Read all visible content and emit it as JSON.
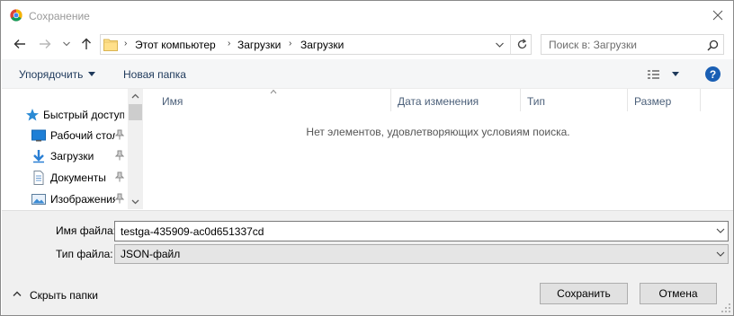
{
  "window": {
    "title": "Сохранение",
    "app_icon": "chrome-icon",
    "close_icon": "close-icon"
  },
  "navigation": {
    "back_icon": "back-arrow-icon",
    "forward_icon": "forward-arrow-icon",
    "up_icon": "up-arrow-icon",
    "breadcrumbs": [
      "Этот компьютер",
      "Загрузки",
      "Загрузки"
    ],
    "search_placeholder": "Поиск в: Загрузки"
  },
  "toolbar": {
    "organize_label": "Упорядочить",
    "new_folder_label": "Новая папка",
    "help_label": "?"
  },
  "sidebar": {
    "items": [
      {
        "label": "Быстрый доступ",
        "icon": "star-icon",
        "pinned": false
      },
      {
        "label": "Рабочий стол",
        "icon": "desktop-icon",
        "pinned": true
      },
      {
        "label": "Загрузки",
        "icon": "download-icon",
        "pinned": true
      },
      {
        "label": "Документы",
        "icon": "document-icon",
        "pinned": true
      },
      {
        "label": "Изображения",
        "icon": "pictures-icon",
        "pinned": true
      }
    ]
  },
  "file_list": {
    "columns": [
      "Имя",
      "Дата изменения",
      "Тип",
      "Размер"
    ],
    "empty_message": "Нет элементов, удовлетворяющих условиям поиска."
  },
  "form": {
    "filename_label": "Имя файла:",
    "filename_value": "testga-435909-ac0d651337cd",
    "filetype_label": "Тип файла:",
    "filetype_value": "JSON-файл",
    "hide_folders_label": "Скрыть папки",
    "save_label": "Сохранить",
    "cancel_label": "Отмена"
  },
  "colors": {
    "accent": "#1a5fb4",
    "toolbar_text": "#1e395b",
    "toolbar_bg": "#f5f6f7",
    "bottom_bg": "#f0f0f0"
  }
}
